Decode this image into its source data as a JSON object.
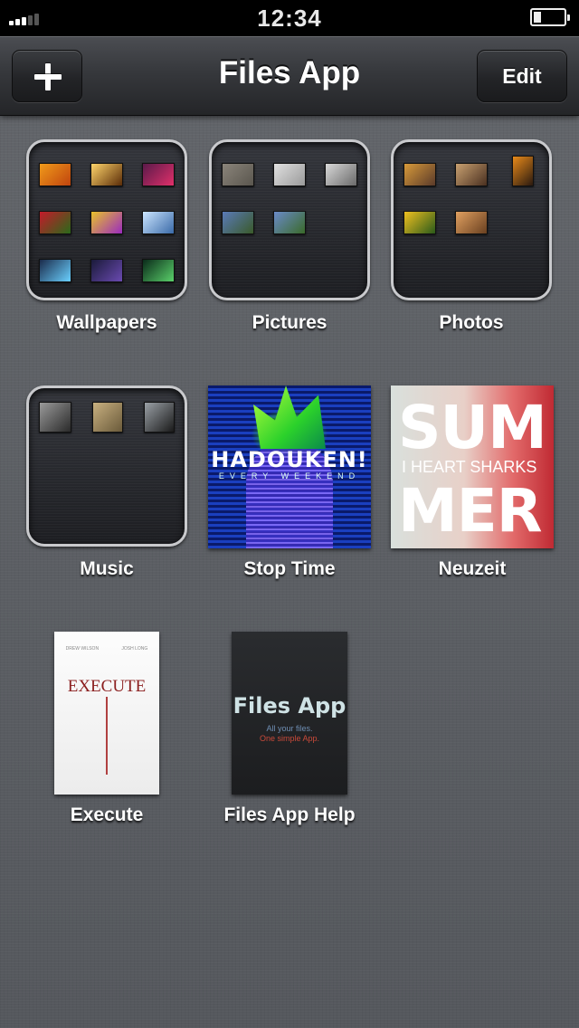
{
  "status_bar": {
    "time": "12:34",
    "signal_bars": 3,
    "battery_level": 0.2
  },
  "nav": {
    "title": "Files App",
    "edit_label": "Edit",
    "add_icon": "plus-icon"
  },
  "folders": [
    {
      "label": "Wallpapers",
      "thumbs": [
        [
          "#f09a1a",
          "#c0440e"
        ],
        [
          "#ffd46a",
          "#5a2c08"
        ],
        [
          "#5a1a4a",
          "#e0306a"
        ],
        [
          "#c41a2a",
          "#2a6a1a"
        ],
        [
          "#e8c22a",
          "#9a2abf"
        ],
        [
          "#cce6ff",
          "#3a6aa8"
        ],
        [
          "#1a2a4a",
          "#6ad0ff"
        ],
        [
          "#1a1a3a",
          "#6a4ab0"
        ],
        [
          "#0a2a1a",
          "#5ad06a"
        ]
      ]
    },
    {
      "label": "Pictures",
      "thumbs": [
        [
          "#8a847a",
          "#5a564e"
        ],
        [
          "#e0e0e0",
          "#9a9a9a"
        ],
        [
          "#d8d8d8",
          "#6a6a6a"
        ],
        [
          "#5a7ab8",
          "#3a5a2a"
        ],
        [
          "#6a8ac8",
          "#3a6a2a"
        ]
      ]
    },
    {
      "label": "Photos",
      "thumbs": [
        [
          "#d89a3a",
          "#5a3a2a"
        ],
        [
          "#c8a070",
          "#4a3020"
        ],
        [
          "#e88a1a",
          "#2a1a10"
        ],
        [
          "#f0c020",
          "#2a5a1a"
        ],
        [
          "#e0a060",
          "#6a4020"
        ]
      ]
    },
    {
      "label": "Music",
      "thumbs": [
        [
          "#9a9a9a",
          "#2a2a2a"
        ],
        [
          "#c8b080",
          "#6a5a3a"
        ],
        [
          "#9aa0a6",
          "#1a1a1a"
        ]
      ]
    }
  ],
  "albums": [
    {
      "label": "Stop Time",
      "cover_title": "HADOUKEN!",
      "cover_sub": "EVERY WEEKEND"
    },
    {
      "label": "Neuzeit",
      "cover_line1": "SUM",
      "cover_mid": "I HEART SHARKS",
      "cover_line2": "MER"
    }
  ],
  "books": [
    {
      "label": "Execute",
      "cover_title": "EXECUTE",
      "author1": "DREW WILSON",
      "author2": "JOSH LONG"
    },
    {
      "label": "Files App Help",
      "cover_title": "Files App",
      "cover_sub1": "All your files.",
      "cover_sub2": "One simple App."
    }
  ]
}
